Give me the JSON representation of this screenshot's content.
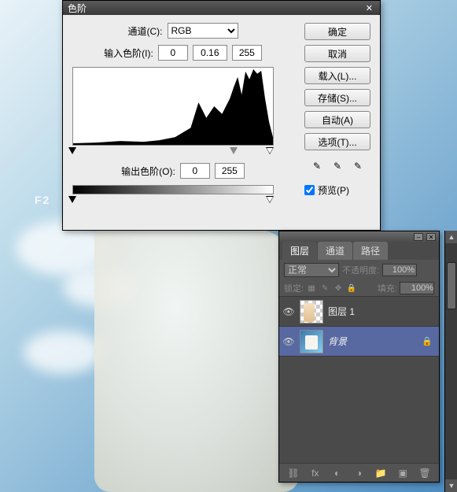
{
  "dialog": {
    "title": "色阶",
    "channel_label": "通道(C):",
    "channel_value": "RGB",
    "input_label": "输入色阶(I):",
    "input_black": "0",
    "input_gamma": "0.16",
    "input_white": "255",
    "output_label": "输出色阶(O):",
    "output_black": "0",
    "output_white": "255",
    "buttons": {
      "ok": "确定",
      "cancel": "取消",
      "load": "载入(L)...",
      "save": "存储(S)...",
      "auto": "自动(A)",
      "options": "选项(T)..."
    },
    "preview_label": "预览(P)",
    "preview_checked": true
  },
  "panel": {
    "tabs": {
      "layers": "图层",
      "channels": "通道",
      "paths": "路径"
    },
    "blend_mode": "正常",
    "opacity_label": "不透明度:",
    "opacity_value": "100%",
    "lock_label": "锁定:",
    "fill_label": "填充:",
    "fill_value": "100%",
    "layers": [
      {
        "name": "图层 1",
        "locked": false
      },
      {
        "name": "背景",
        "locked": true
      }
    ]
  },
  "brand": "F2",
  "icons": {
    "close": "✕",
    "eyedrop": "✎",
    "eye": "👁",
    "lock": "🔒",
    "link": "⛓",
    "fx": "fx",
    "mask": "◐",
    "adjust": "◑",
    "folder": "📁",
    "new": "▣",
    "trash": "🗑",
    "minimize": "–"
  },
  "chart_data": {
    "type": "area",
    "title": "Histogram",
    "xlabel": "",
    "ylabel": "",
    "xlim": [
      0,
      255
    ],
    "ylim": [
      0,
      100
    ],
    "x": [
      0,
      30,
      60,
      90,
      110,
      130,
      150,
      160,
      170,
      180,
      190,
      200,
      205,
      210,
      215,
      220,
      225,
      230,
      235,
      240,
      245,
      250,
      255
    ],
    "values": [
      2,
      3,
      5,
      4,
      6,
      10,
      22,
      55,
      35,
      50,
      40,
      60,
      75,
      88,
      65,
      95,
      85,
      98,
      92,
      96,
      60,
      30,
      10
    ]
  }
}
